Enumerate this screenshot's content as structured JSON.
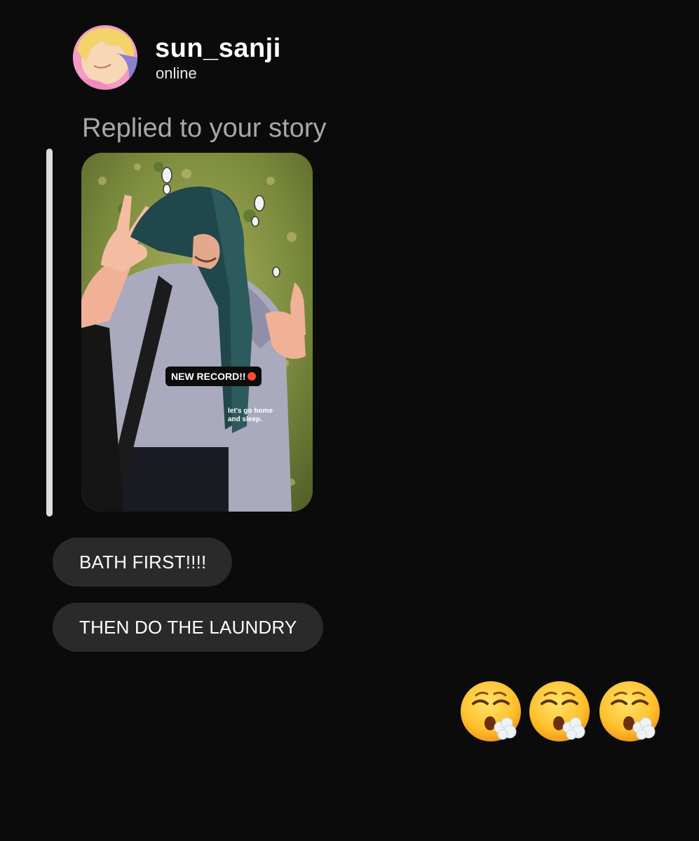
{
  "header": {
    "username": "sun_sanji",
    "status": "online"
  },
  "reply": {
    "label": "Replied to your story"
  },
  "story": {
    "sticker_text": "NEW RECORD!!",
    "caption": "let's go home and sleep."
  },
  "messages": [
    {
      "text": "BATH FIRST!!!!"
    },
    {
      "text": "THEN DO THE LAUNDRY"
    }
  ],
  "reaction": {
    "icon": "exhaling-face-emoji",
    "count": 3
  },
  "colors": {
    "background": "#0b0b0b",
    "bubble": "#2b2a2a",
    "muted_text": "#a8a8a8",
    "reply_bar": "#dcdcdc"
  }
}
